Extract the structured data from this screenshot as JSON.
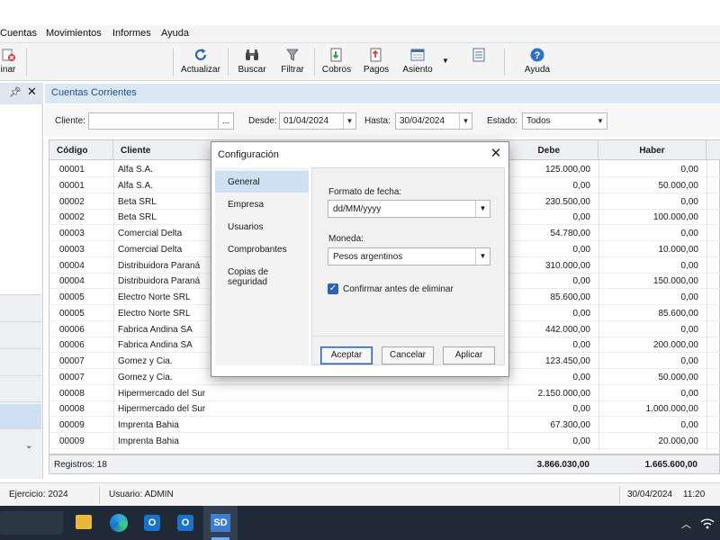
{
  "menu": [
    "Cuentas",
    "Movimientos",
    "Informes",
    "Ayuda"
  ],
  "toolbar": {
    "partial_label": "inar",
    "buttons": [
      "Actualizar",
      "Buscar",
      "Filtrar",
      "Cobros",
      "Pagos",
      "Asiento",
      "Ayuda"
    ]
  },
  "left_panel": {
    "pin_icon": "pin-icon",
    "close_icon": "close-icon",
    "collapse_icon": "chevron-down-icon"
  },
  "main": {
    "title": "Cuentas Corrientes"
  },
  "filters": {
    "cliente_label": "Cliente:",
    "cliente_value": "",
    "browse_label": "...",
    "desde_label": "Desde:",
    "desde_value": "01/04/2024",
    "hasta_label": "Hasta:",
    "hasta_value": "30/04/2024",
    "estado_label": "Estado:",
    "estado_value": "Todos"
  },
  "grid": {
    "columns": [
      "Código",
      "Cliente",
      "Debe",
      "Haber"
    ],
    "rows": [
      {
        "codigo": "00001",
        "cliente": "Alfa S.A.",
        "debe": "125.000,00",
        "haber": "0,00"
      },
      {
        "codigo": "00001",
        "cliente": "Alfa S.A.",
        "debe": "0,00",
        "haber": "50.000,00"
      },
      {
        "codigo": "00002",
        "cliente": "Beta SRL",
        "debe": "230.500,00",
        "haber": "0,00"
      },
      {
        "codigo": "00002",
        "cliente": "Beta SRL",
        "debe": "0,00",
        "haber": "100.000,00"
      },
      {
        "codigo": "00003",
        "cliente": "Comercial Delta",
        "debe": "54.780,00",
        "haber": "0,00"
      },
      {
        "codigo": "00003",
        "cliente": "Comercial Delta",
        "debe": "0,00",
        "haber": "10.000,00"
      },
      {
        "codigo": "00004",
        "cliente": "Distribuidora Paraná",
        "debe": "310.000,00",
        "haber": "0,00"
      },
      {
        "codigo": "00004",
        "cliente": "Distribuidora Paraná",
        "debe": "0,00",
        "haber": "150.000,00"
      },
      {
        "codigo": "00005",
        "cliente": "Electro Norte SRL",
        "debe": "85.600,00",
        "haber": "0,00"
      },
      {
        "codigo": "00005",
        "cliente": "Electro Norte SRL",
        "debe": "0,00",
        "haber": "85.600,00"
      },
      {
        "codigo": "00006",
        "cliente": "Fabrica Andina SA",
        "debe": "442.000,00",
        "haber": "0,00"
      },
      {
        "codigo": "00006",
        "cliente": "Fabrica Andina SA",
        "debe": "0,00",
        "haber": "200.000,00"
      },
      {
        "codigo": "00007",
        "cliente": "Gomez y Cia.",
        "debe": "123.450,00",
        "haber": "0,00"
      },
      {
        "codigo": "00007",
        "cliente": "Gomez y Cia.",
        "debe": "0,00",
        "haber": "50.000,00"
      },
      {
        "codigo": "00008",
        "cliente": "Hipermercado del Sur",
        "debe": "2.150.000,00",
        "haber": "0,00"
      },
      {
        "codigo": "00008",
        "cliente": "Hipermercado del Sur",
        "debe": "0,00",
        "haber": "1.000.000,00"
      },
      {
        "codigo": "00009",
        "cliente": "Imprenta Bahia",
        "debe": "67.300,00",
        "haber": "0,00"
      },
      {
        "codigo": "00009",
        "cliente": "Imprenta Bahia",
        "debe": "0,00",
        "haber": "20.000,00"
      }
    ],
    "footer": {
      "registros": "Registros: 18",
      "total_debe": "3.866.030,00",
      "total_haber": "1.665.600,00"
    }
  },
  "status": {
    "ejercicio": "Ejercicio: 2024",
    "usuario": "Usuario: ADMIN",
    "fecha": "30/04/2024",
    "hora": "11:20"
  },
  "dialog": {
    "title": "Configuración",
    "nav": [
      "General",
      "Empresa",
      "Usuarios",
      "Comprobantes",
      "Copias de seguridad"
    ],
    "selected_nav": 0,
    "formato_label": "Formato de fecha:",
    "formato_value": "dd/MM/yyyy",
    "moneda_label": "Moneda:",
    "moneda_value": "Pesos argentinos",
    "confirm_label": "Confirmar antes de eliminar",
    "confirm_checked": true,
    "buttons": {
      "ok": "Aceptar",
      "cancel": "Cancelar",
      "apply": "Aplicar"
    }
  },
  "taskbar": {
    "active_app": "SD",
    "colors": {
      "taskbar": "#202a36",
      "accent": "#3c7ecf"
    }
  }
}
